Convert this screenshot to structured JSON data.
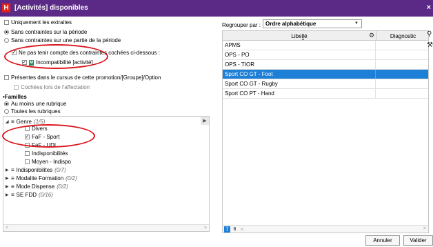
{
  "window": {
    "app_letter": "H",
    "title": "[Activités] disponibles",
    "close_glyph": "×"
  },
  "left": {
    "extraits_only": "Uniquement les extraites",
    "period_options": [
      "Sans contraintes sur la période",
      "Sans contraintes sur une partie de la période"
    ],
    "ignore_constraints": "Ne pas tenir compte des contraintes cochées ci-dessous :",
    "incompat_badge": "M",
    "incompat_label": "Incompatibilité [activité]",
    "presentes": "Présentes dans le cursus de cette promotion/[Groupe]/Option",
    "cochees": "Cochées lors de l'affectation",
    "familles_title": "•Familles",
    "familles_options": [
      "Au moins une rubrique",
      "Toutes les rubriques"
    ],
    "tree": {
      "genre": {
        "label": "Genre",
        "count": "(1/5)"
      },
      "genre_items": [
        "Divers",
        "FaF - Sport",
        "FaF - UDL",
        "Indisponibilités",
        "Moyen - Indispo"
      ],
      "families": [
        {
          "label": "Indisponibilites",
          "count": "(0/7)"
        },
        {
          "label": "Modalite Formation",
          "count": "(0/2)"
        },
        {
          "label": "Mode Dispense",
          "count": "(0/2)"
        },
        {
          "label": "SE FDD",
          "count": "(0/16)"
        }
      ]
    }
  },
  "right": {
    "group_label": "Regrouper par :",
    "group_value": "Ordre alphabétique",
    "columns": [
      "Libellé",
      "Diagnostic"
    ],
    "rows": [
      "APMS",
      "OPS - PO",
      "OPS - TIOR",
      "Sport CO GT - Foot",
      "Sport CO GT - Rugby",
      "Sport CO PT - Hand"
    ],
    "selected_row": "Sport CO GT - Foot",
    "pages": [
      "1",
      "6"
    ]
  },
  "footer": {
    "cancel": "Annuler",
    "validate": "Valider"
  },
  "colors": {
    "titlebar": "#5b2a86",
    "selection": "#1e7fd6",
    "annotation": "#d9151b",
    "logo": "#e2231a"
  }
}
